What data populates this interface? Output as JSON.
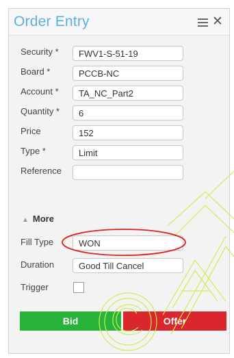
{
  "window": {
    "title": "Order Entry"
  },
  "fields": [
    {
      "label": "Security *",
      "value": "FWV1-S-51-19"
    },
    {
      "label": "Board *",
      "value": "PCCB-NC"
    },
    {
      "label": "Account *",
      "value": "TA_NC_Part2"
    },
    {
      "label": "Quantity *",
      "value": "6"
    },
    {
      "label": "Price",
      "value": "152"
    },
    {
      "label": "Type *",
      "value": "Limit"
    },
    {
      "label": "Reference",
      "value": ""
    }
  ],
  "more": {
    "label": "More"
  },
  "more_fields": [
    {
      "label": "Fill Type",
      "value": "WON"
    },
    {
      "label": "Duration",
      "value": "Good Till Cancel"
    }
  ],
  "trigger": {
    "label": "Trigger",
    "checked": false
  },
  "actions": {
    "bid": "Bid",
    "offer": "Offer"
  },
  "colors": {
    "title": "#5ab0e2",
    "bid": "#27b33a",
    "offer": "#d9272d",
    "annotation": "#e02020",
    "watermark": "#ccee55"
  },
  "icons": {
    "menu": "hamburger-icon",
    "close": "close-icon",
    "more": "caret-up-icon"
  }
}
